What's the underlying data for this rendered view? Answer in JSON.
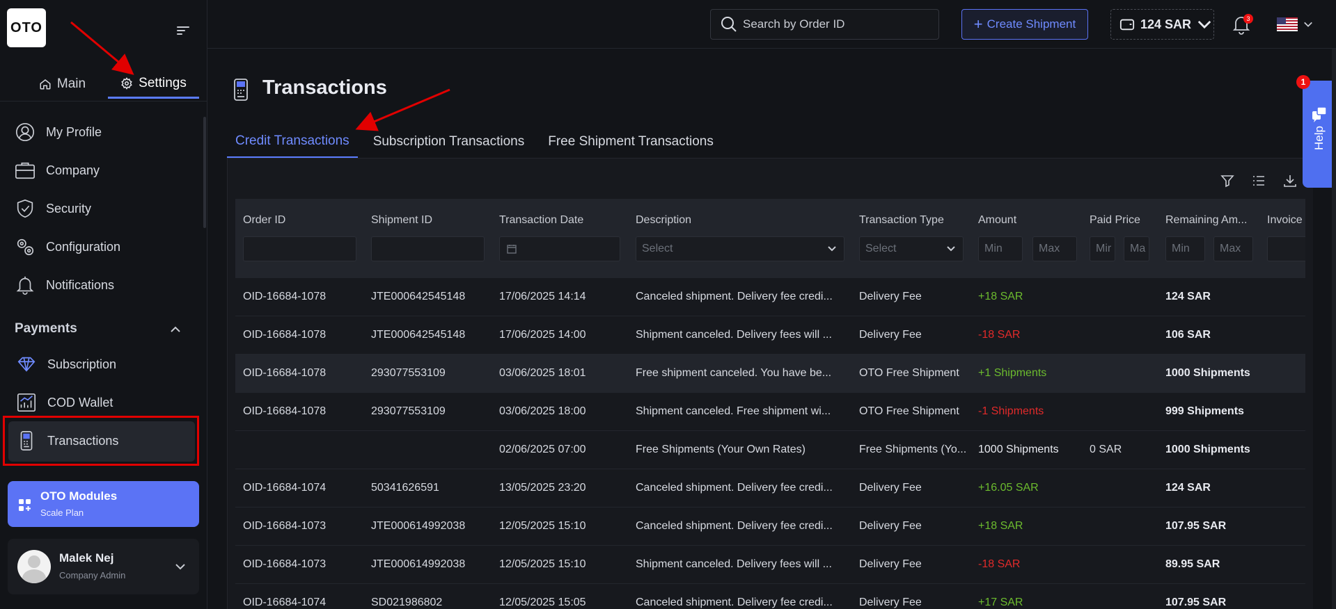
{
  "app": {
    "logo_text": "OTO"
  },
  "sidebar": {
    "tabs": [
      {
        "label": "Main",
        "icon": "home-icon"
      },
      {
        "label": "Settings",
        "icon": "gear-icon",
        "active": true
      }
    ],
    "items": [
      {
        "label": "My Profile",
        "icon": "user-icon"
      },
      {
        "label": "Company",
        "icon": "briefcase-icon"
      },
      {
        "label": "Security",
        "icon": "shield-icon"
      },
      {
        "label": "Configuration",
        "icon": "gears-icon"
      },
      {
        "label": "Notifications",
        "icon": "bell-icon"
      }
    ],
    "payments_title": "Payments",
    "payments_items": [
      {
        "label": "Subscription",
        "icon": "diamond-icon"
      },
      {
        "label": "COD Wallet",
        "icon": "wallet-chart-icon"
      },
      {
        "label": "Transactions",
        "icon": "terminal-icon",
        "active": true
      }
    ],
    "modules_card": {
      "title": "OTO Modules",
      "subtitle": "Scale Plan"
    },
    "user": {
      "name": "Malek Nej",
      "role": "Company Admin"
    }
  },
  "topbar": {
    "search_placeholder": "Search by Order ID",
    "create_label": "Create Shipment",
    "wallet_balance": "124 SAR",
    "notification_count": "3"
  },
  "page": {
    "title": "Transactions",
    "tabs": [
      {
        "label": "Credit Transactions",
        "active": true
      },
      {
        "label": "Subscription Transactions"
      },
      {
        "label": "Free Shipment Transactions"
      }
    ]
  },
  "table": {
    "columns": [
      "Order ID",
      "Shipment ID",
      "Transaction Date",
      "Description",
      "Transaction Type",
      "Amount",
      "Paid Price",
      "Remaining Am...",
      "Invoice"
    ],
    "filters": {
      "select": "Select",
      "min": "Min",
      "max": "Max",
      "min_short": "Mir",
      "max_short": "Ma"
    },
    "rows": [
      {
        "order": "OID-16684-1078",
        "shipment": "JTE000642545148",
        "date": "17/06/2025 14:14",
        "desc": "Canceled shipment. Delivery fee credi...",
        "type": "Delivery Fee",
        "amount": "+18 SAR",
        "amount_kind": "pos",
        "paid": "",
        "remaining": "124 SAR"
      },
      {
        "order": "OID-16684-1078",
        "shipment": "JTE000642545148",
        "date": "17/06/2025 14:00",
        "desc": "Shipment canceled. Delivery fees will ...",
        "type": "Delivery Fee",
        "amount": "-18 SAR",
        "amount_kind": "neg",
        "paid": "",
        "remaining": "106 SAR"
      },
      {
        "order": "OID-16684-1078",
        "shipment": "293077553109",
        "date": "03/06/2025 18:01",
        "desc": "Free shipment canceled. You have be...",
        "type": "OTO Free Shipment",
        "amount": "+1 Shipments",
        "amount_kind": "pos",
        "paid": "",
        "remaining": "1000 Shipments",
        "highlight": true
      },
      {
        "order": "OID-16684-1078",
        "shipment": "293077553109",
        "date": "03/06/2025 18:00",
        "desc": "Shipment canceled. Free shipment wi...",
        "type": "OTO Free Shipment",
        "amount": "-1 Shipments",
        "amount_kind": "neg",
        "paid": "",
        "remaining": "999 Shipments"
      },
      {
        "order": "",
        "shipment": "",
        "date": "02/06/2025 07:00",
        "desc": "Free Shipments (Your Own Rates)",
        "type": "Free Shipments (Yo...",
        "amount": "1000 Shipments",
        "amount_kind": "neutral",
        "paid": "0 SAR",
        "remaining": "1000 Shipments"
      },
      {
        "order": "OID-16684-1074",
        "shipment": "50341626591",
        "date": "13/05/2025 23:20",
        "desc": "Canceled shipment. Delivery fee credi...",
        "type": "Delivery Fee",
        "amount": "+16.05 SAR",
        "amount_kind": "pos",
        "paid": "",
        "remaining": "124 SAR"
      },
      {
        "order": "OID-16684-1073",
        "shipment": "JTE000614992038",
        "date": "12/05/2025 15:10",
        "desc": "Canceled shipment. Delivery fee credi...",
        "type": "Delivery Fee",
        "amount": "+18 SAR",
        "amount_kind": "pos",
        "paid": "",
        "remaining": "107.95 SAR"
      },
      {
        "order": "OID-16684-1073",
        "shipment": "JTE000614992038",
        "date": "12/05/2025 15:10",
        "desc": "Shipment canceled. Delivery fees will ...",
        "type": "Delivery Fee",
        "amount": "-18 SAR",
        "amount_kind": "neg",
        "paid": "",
        "remaining": "89.95 SAR"
      },
      {
        "order": "OID-16684-1074",
        "shipment": "SD021986802",
        "date": "12/05/2025 15:05",
        "desc": "Canceled shipment. Delivery fee credi...",
        "type": "Delivery Fee",
        "amount": "+17 SAR",
        "amount_kind": "pos",
        "paid": "",
        "remaining": "107.95 SAR"
      }
    ]
  },
  "help": {
    "label": "Help",
    "badge": "1"
  },
  "colors": {
    "accent": "#5b73f5",
    "positive": "#6cbb2e",
    "negative": "#e12a2a",
    "annotation": "#e10000"
  }
}
